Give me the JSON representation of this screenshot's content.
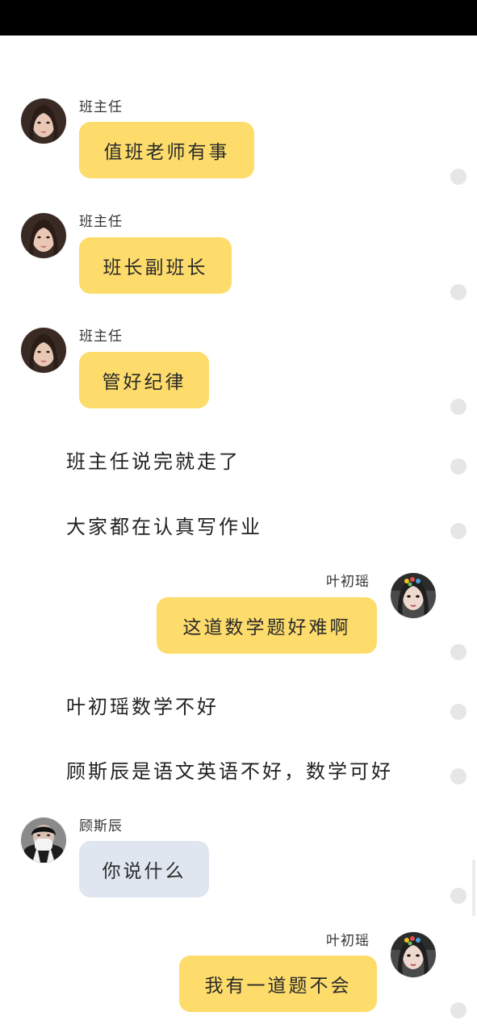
{
  "messages": [
    {
      "kind": "left",
      "name": "班主任",
      "text": "值班老师有事",
      "avatar": "teacher-avatar"
    },
    {
      "kind": "left",
      "name": "班主任",
      "text": "班长副班长",
      "avatar": "teacher-avatar"
    },
    {
      "kind": "left",
      "name": "班主任",
      "text": "管好纪律",
      "avatar": "teacher-avatar"
    },
    {
      "kind": "narration",
      "text": "班主任说完就走了"
    },
    {
      "kind": "narration",
      "text": "大家都在认真写作业"
    },
    {
      "kind": "right",
      "name": "叶初瑶",
      "text": "这道数学题好难啊",
      "avatar": "girl-avatar"
    },
    {
      "kind": "narration",
      "text": "叶初瑶数学不好"
    },
    {
      "kind": "narration",
      "text": "顾斯辰是语文英语不好，数学可好"
    },
    {
      "kind": "left",
      "name": "顾斯辰",
      "text": "你说什么",
      "avatar": "boy-avatar"
    },
    {
      "kind": "right",
      "name": "叶初瑶",
      "text": "我有一道题不会",
      "avatar": "girl-avatar"
    }
  ],
  "colors": {
    "bubble_yellow": "#fddc6c",
    "bubble_blue": "#dfe6ef",
    "status_bar": "#000000",
    "background": "#ffffff"
  }
}
